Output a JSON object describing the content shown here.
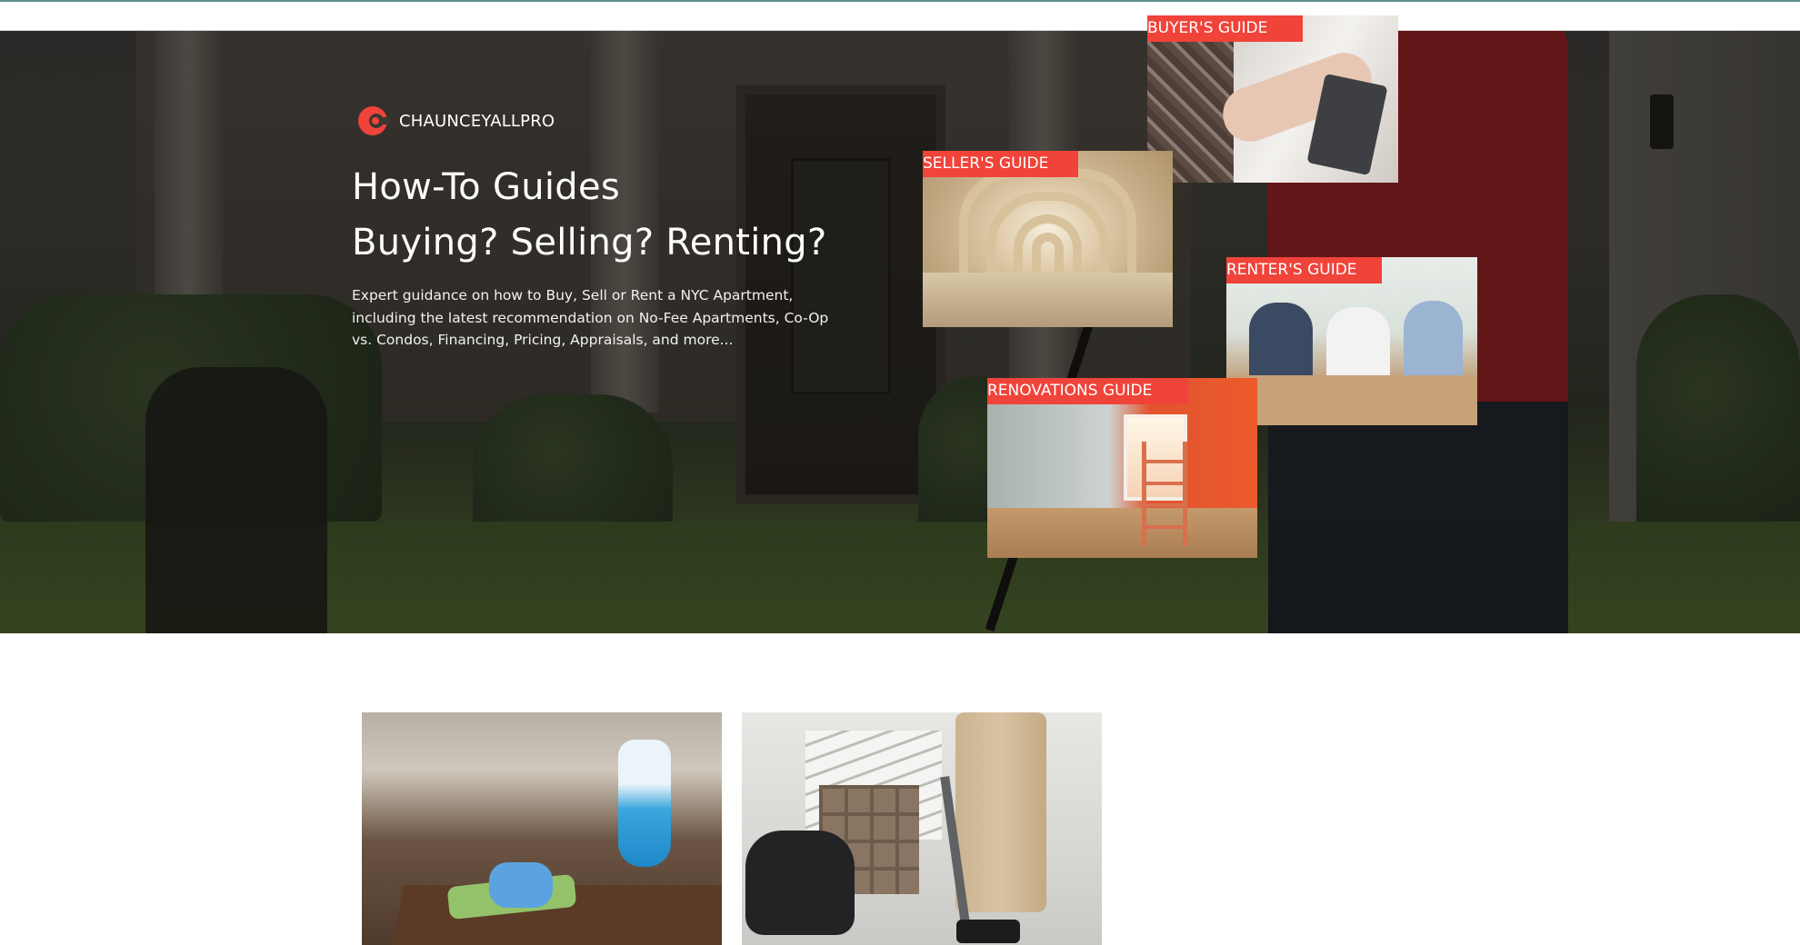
{
  "brand": {
    "name": "CHAUNCEYALLPRO",
    "logo_icon": "c-mark-logo-icon",
    "accent": "#f0433a"
  },
  "hero": {
    "title_line1": "How-To Guides",
    "title_line2": "Buying? Selling? Renting?",
    "description": "Expert guidance on how to Buy, Sell or Rent a NYC Apartment, including the latest recommendation on No-Fee Apartments, Co-Op vs. Condos, Financing, Pricing, Appraisals, and more..."
  },
  "guides": [
    {
      "id": "buyer",
      "label": "BUYER'S GUIDE"
    },
    {
      "id": "seller",
      "label": "SELLER'S GUIDE"
    },
    {
      "id": "renter",
      "label": "RENTER'S GUIDE"
    },
    {
      "id": "renovation",
      "label": "RENOVATIONS GUIDE"
    }
  ],
  "colors": {
    "tag_background": "#f0433a",
    "top_border": "#5c8f8a"
  }
}
